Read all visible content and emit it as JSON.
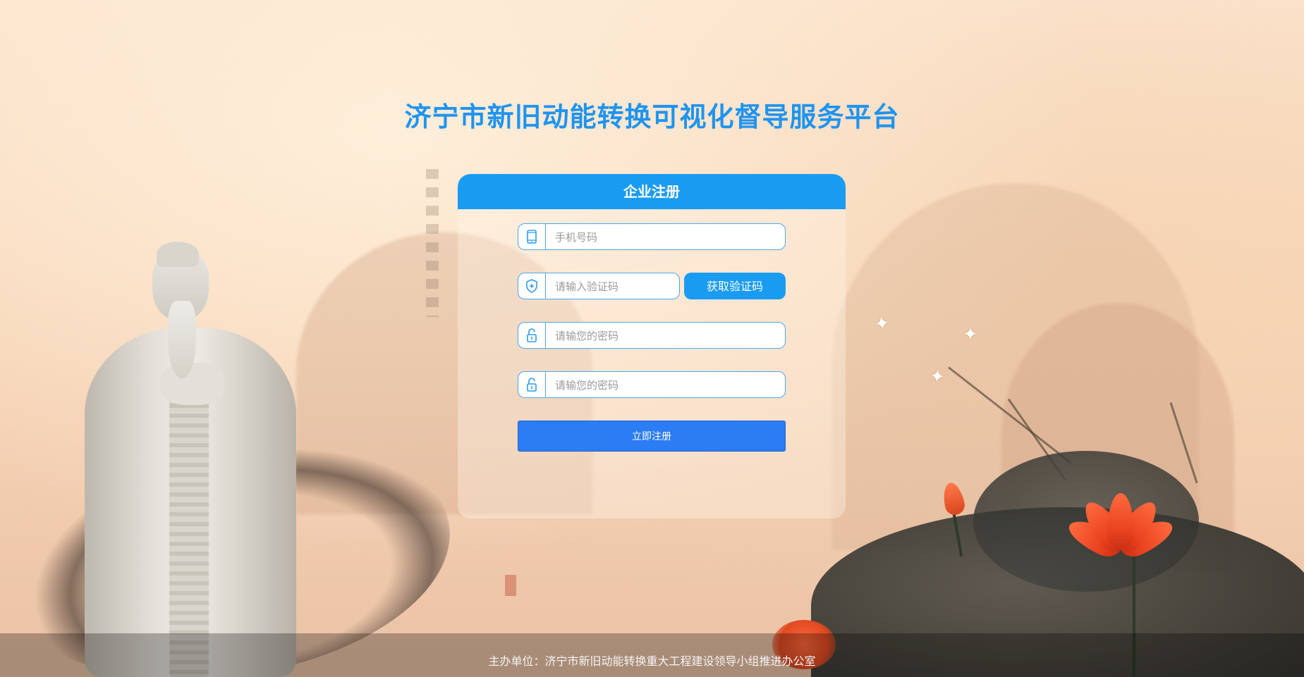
{
  "page": {
    "title": "济宁市新旧动能转换可视化督导服务平台"
  },
  "panel": {
    "header": "企业注册",
    "phone": {
      "placeholder": "手机号码",
      "icon": "mobile-phone-icon"
    },
    "code": {
      "placeholder": "请输入验证码",
      "icon": "shield-plus-icon"
    },
    "get_code_label": "获取验证码",
    "password": {
      "placeholder": "请输您的密码",
      "icon": "lock-icon"
    },
    "password_confirm": {
      "placeholder": "请输您的密码",
      "icon": "lock-icon"
    },
    "submit_label": "立即注册"
  },
  "footer": {
    "text": "主办单位：济宁市新旧动能转换重大工程建设领导小组推进办公室"
  },
  "colors": {
    "title": "#1f94f0",
    "accent": "#1a9bf2",
    "submit": "#2c7cf4",
    "border": "#4aa8f0"
  }
}
